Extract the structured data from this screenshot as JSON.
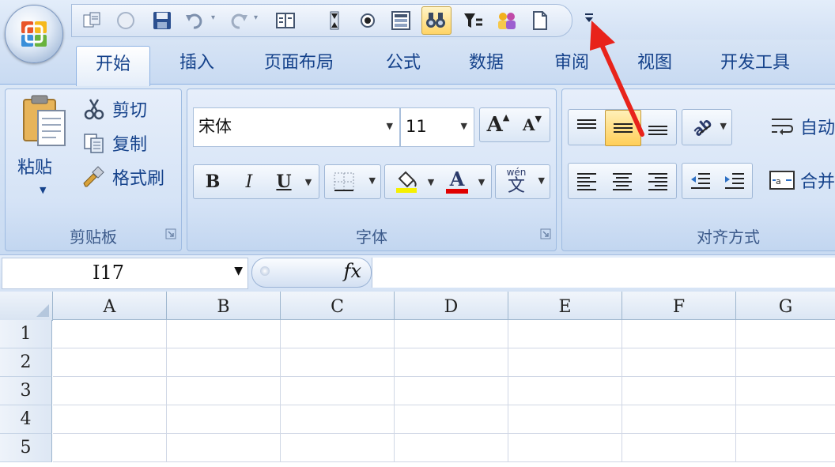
{
  "quick_access_toolbar": {
    "icons": [
      "office-button-icon",
      "paste-special-icon",
      "circle-icon",
      "save-icon",
      "undo-icon",
      "redo-icon",
      "record-macro-icon",
      "sort-icon",
      "radio-icon",
      "form-icon",
      "find-icon",
      "filter-icon",
      "people-icon",
      "new-document-icon"
    ],
    "customize_icon": "customize-dropdown-icon"
  },
  "tabs": [
    {
      "label": "开始",
      "active": true
    },
    {
      "label": "插入"
    },
    {
      "label": "页面布局"
    },
    {
      "label": "公式"
    },
    {
      "label": "数据"
    },
    {
      "label": "审阅"
    },
    {
      "label": "视图"
    },
    {
      "label": "开发工具"
    }
  ],
  "clipboard": {
    "paste_label": "粘贴",
    "cut_label": "剪切",
    "copy_label": "复制",
    "format_painter_label": "格式刷",
    "group_label": "剪贴板"
  },
  "font": {
    "font_name": "宋体",
    "font_size": "11",
    "grow_label": "A",
    "shrink_label": "A",
    "bold_label": "B",
    "italic_label": "I",
    "underline_label": "U",
    "font_color_label": "A",
    "phonetic_label": "wén",
    "phonetic_char": "文",
    "fill_color": "#f5f000",
    "font_color": "#e00000",
    "group_label": "字体"
  },
  "alignment": {
    "wrap_label": "自动",
    "merge_label": "合并",
    "group_label": "对齐方式"
  },
  "formula_bar": {
    "name_box": "I17",
    "fx_label": "fx",
    "formula": ""
  },
  "grid": {
    "columns": [
      "A",
      "B",
      "C",
      "D",
      "E",
      "F",
      "G"
    ],
    "rows": [
      "1",
      "2",
      "3",
      "4",
      "5"
    ]
  },
  "annotation_color": "#e8231b"
}
